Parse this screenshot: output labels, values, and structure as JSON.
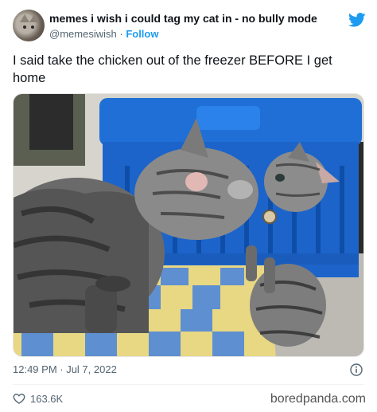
{
  "tweet": {
    "display_name": "memes i wish i could tag my cat in - no bully mode",
    "handle": "@memesiwish",
    "separator": "·",
    "follow_label": "Follow",
    "text": "I said take the chicken out of the freezer BEFORE I get home",
    "timestamp": "12:49 PM · Jul 7, 2022",
    "likes": "163.6K"
  },
  "icons": {
    "platform": "twitter-bird-icon",
    "info": "info-icon",
    "like": "heart-icon"
  },
  "colors": {
    "accent": "#1d9bf0",
    "secondary_text": "#536471",
    "primary_text": "#0f1419"
  },
  "watermark": "boredpanda.com"
}
